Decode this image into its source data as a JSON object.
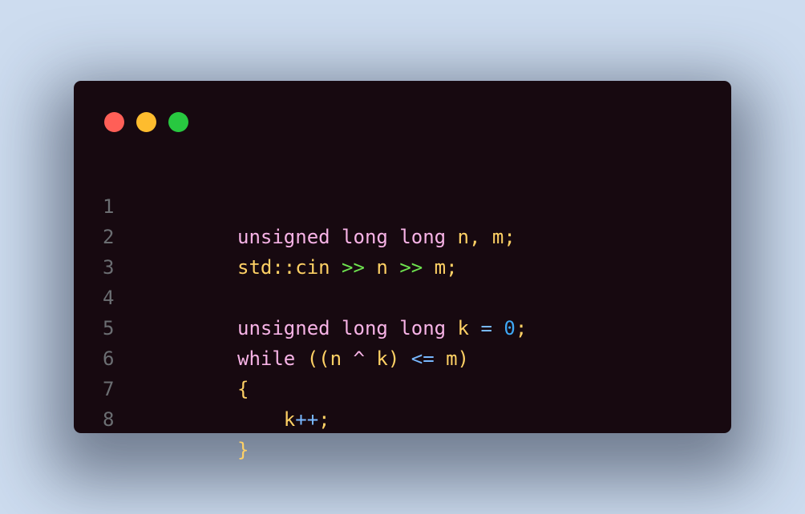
{
  "window": {
    "controls": [
      {
        "name": "close",
        "color": "#ff5f57"
      },
      {
        "name": "minimize",
        "color": "#febc2e"
      },
      {
        "name": "maximize",
        "color": "#28c840"
      }
    ]
  },
  "colors": {
    "background": "#cddcef",
    "editor_bg": "#170910",
    "line_number": "#6b6e72",
    "keyword": "#f7b3e6",
    "identifier": "#ffd165",
    "operator": "#78b8ff",
    "stream_operator": "#6ee24f",
    "number": "#3ea7f5"
  },
  "code": {
    "line_numbers": [
      "1",
      "2",
      "3",
      "4",
      "5",
      "6",
      "7",
      "8"
    ],
    "lines": [
      [
        {
          "t": "unsigned long long",
          "c": "kw"
        },
        {
          "t": " n, m;",
          "c": "id"
        }
      ],
      [
        {
          "t": "std::cin",
          "c": "id"
        },
        {
          "t": " ",
          "c": "id"
        },
        {
          "t": ">>",
          "c": "io"
        },
        {
          "t": " n ",
          "c": "id"
        },
        {
          "t": ">>",
          "c": "io"
        },
        {
          "t": " m;",
          "c": "id"
        }
      ],
      [],
      [
        {
          "t": "unsigned long long",
          "c": "kw"
        },
        {
          "t": " k ",
          "c": "id"
        },
        {
          "t": "=",
          "c": "op"
        },
        {
          "t": " ",
          "c": "id"
        },
        {
          "t": "0",
          "c": "num"
        },
        {
          "t": ";",
          "c": "id"
        }
      ],
      [
        {
          "t": "while",
          "c": "kw"
        },
        {
          "t": " ((n ",
          "c": "id"
        },
        {
          "t": "^",
          "c": "kw"
        },
        {
          "t": " k) ",
          "c": "id"
        },
        {
          "t": "<=",
          "c": "op"
        },
        {
          "t": " m)",
          "c": "id"
        }
      ],
      [
        {
          "t": "{",
          "c": "id"
        }
      ],
      [
        {
          "t": "    k",
          "c": "id"
        },
        {
          "t": "++",
          "c": "op"
        },
        {
          "t": ";",
          "c": "id"
        }
      ],
      [
        {
          "t": "}",
          "c": "id"
        }
      ]
    ]
  }
}
